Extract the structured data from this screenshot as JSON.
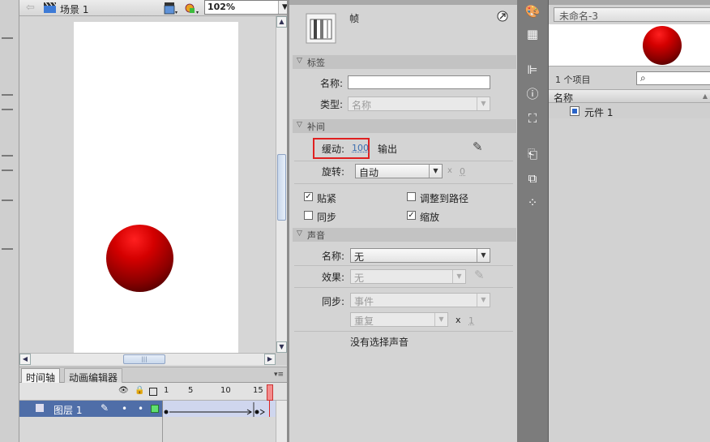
{
  "stage": {
    "scene_label": "场景 1",
    "zoom": "102%",
    "icons": {
      "back": "back-arrow-icon",
      "scene": "clapper-icon",
      "edit_scene": "edit-scene-icon",
      "edit_symbol": "edit-symbol-icon"
    }
  },
  "timeline": {
    "tabs": [
      "时间轴",
      "动画编辑器"
    ],
    "ruler": [
      "1",
      "5",
      "10",
      "15"
    ],
    "layer_name": "图层 1",
    "playhead_frame": 15
  },
  "properties": {
    "frame_label": "帧",
    "sections": {
      "label": "标签",
      "tween": "补间",
      "sound": "声音"
    },
    "label_section": {
      "name_label": "名称:",
      "name_value": "",
      "type_label": "类型:",
      "type_value": "名称"
    },
    "tween_section": {
      "ease_label": "缓动:",
      "ease_value": "100",
      "ease_output": "输出",
      "rotate_label": "旋转:",
      "rotate_value": "自动",
      "rotate_x": "x",
      "rotate_count": "0",
      "snap": "贴紧",
      "snap_checked": "✓",
      "orient": "调整到路径",
      "orient_checked": "",
      "sync": "同步",
      "sync_checked": "",
      "scale": "缩放",
      "scale_checked": "✓"
    },
    "sound_section": {
      "name_label": "名称:",
      "name_value": "无",
      "effect_label": "效果:",
      "effect_value": "无",
      "sync_label": "同步:",
      "sync_value": "事件",
      "repeat_value": "重复",
      "repeat_x": "x",
      "repeat_count": "1",
      "status": "没有选择声音"
    }
  },
  "library": {
    "document": "未命名-3",
    "item_count": "1 个项目",
    "column_name": "名称",
    "items": [
      {
        "name": "元件 1",
        "icon": "graphic-symbol-icon"
      }
    ]
  },
  "colors": {
    "accent_red": "#e02020",
    "layer_blue": "#4f6ea8",
    "ball_red": "#d40000"
  }
}
